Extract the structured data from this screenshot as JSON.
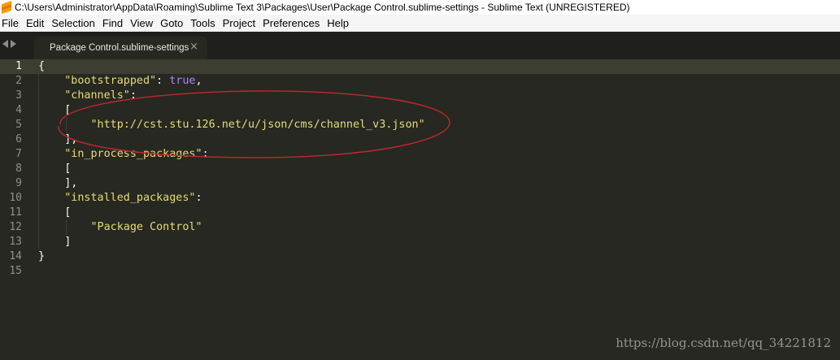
{
  "window": {
    "title": "C:\\Users\\Administrator\\AppData\\Roaming\\Sublime Text 3\\Packages\\User\\Package Control.sublime-settings - Sublime Text (UNREGISTERED)"
  },
  "menu": [
    "File",
    "Edit",
    "Selection",
    "Find",
    "View",
    "Goto",
    "Tools",
    "Project",
    "Preferences",
    "Help"
  ],
  "tab": {
    "label": "Package Control.sublime-settings",
    "close": "×"
  },
  "editor": {
    "line_numbers": [
      "1",
      "2",
      "3",
      "4",
      "5",
      "6",
      "7",
      "8",
      "9",
      "10",
      "11",
      "12",
      "13",
      "14",
      "15"
    ],
    "current_line": 1,
    "lines": {
      "l1": "{",
      "l2_key": "\"bootstrapped\"",
      "l2_sep": ": ",
      "l2_val": "true",
      "l2_end": ",",
      "l3_key": "\"channels\"",
      "l3_end": ":",
      "l4": "[",
      "l5": "\"http://cst.stu.126.net/u/json/cms/channel_v3.json\"",
      "l6": "],",
      "l7_key": "\"in_process_packages\"",
      "l7_end": ":",
      "l8": "[",
      "l9": "],",
      "l10_key": "\"installed_packages\"",
      "l10_end": ":",
      "l11": "[",
      "l12": "\"Package Control\"",
      "l13": "]",
      "l14": "}",
      "l15": ""
    }
  },
  "watermark": "https://blog.csdn.net/qq_34221812",
  "colors": {
    "background": "#272822",
    "string": "#e6db74",
    "constant": "#ae81ff",
    "annotation": "#c0282a"
  }
}
